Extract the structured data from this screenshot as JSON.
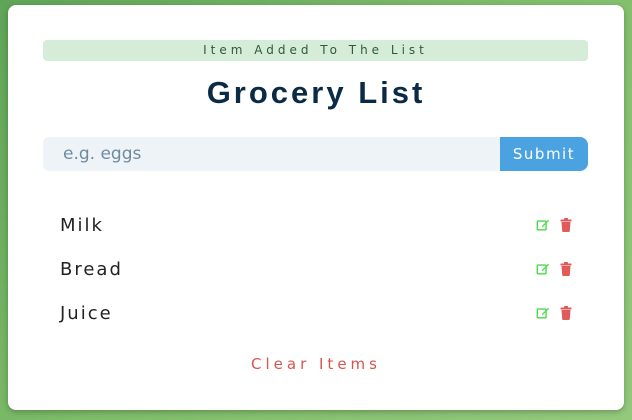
{
  "alert": {
    "text": "Item Added To The List",
    "color": "#d4ecd8"
  },
  "title": "Grocery List",
  "form": {
    "placeholder": "e.g. eggs",
    "value": "",
    "submit_label": "Submit"
  },
  "items": [
    {
      "name": "Milk"
    },
    {
      "name": "Bread"
    },
    {
      "name": "Juice"
    }
  ],
  "item_actions": {
    "edit_icon": "edit-icon",
    "delete_icon": "trash-icon",
    "edit_color": "#4ad94a",
    "delete_color": "#e15b5b"
  },
  "clear_label": "Clear Items",
  "colors": {
    "accent": "#4aa3e0",
    "title": "#0b2a45",
    "danger": "#d9534f"
  }
}
